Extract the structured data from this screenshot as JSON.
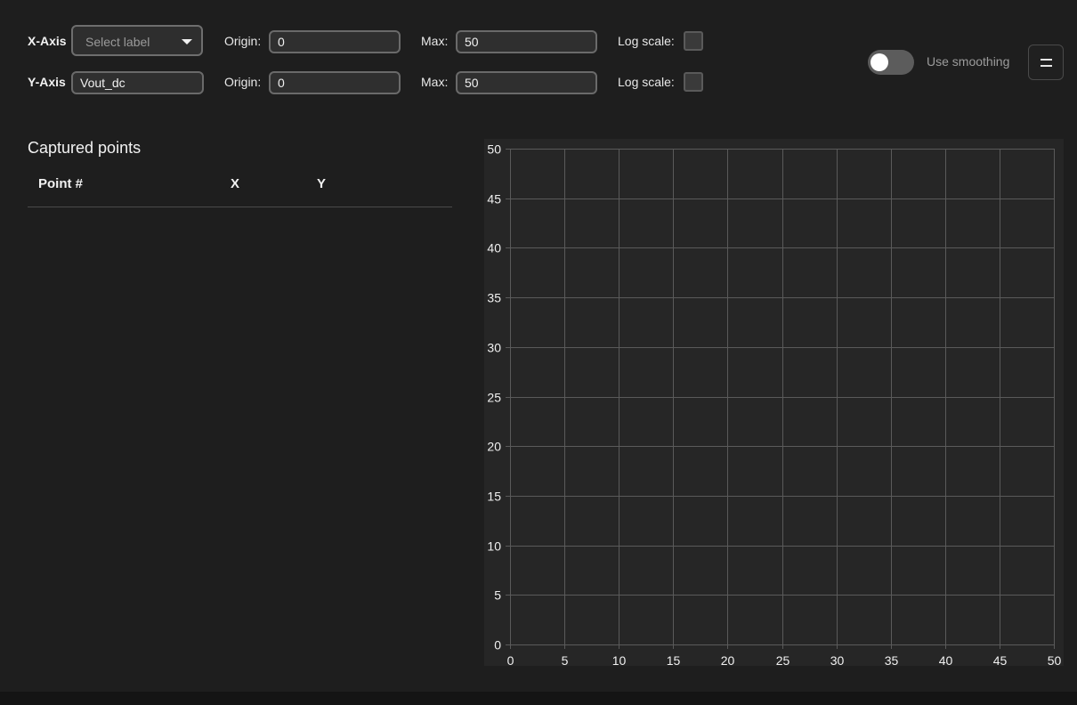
{
  "controls": {
    "x_axis": {
      "label": "X-Axis",
      "select_placeholder": "Select label",
      "origin_label": "Origin:",
      "origin_value": "0",
      "max_label": "Max:",
      "max_value": "50",
      "log_label": "Log scale:",
      "log_checked": false
    },
    "y_axis": {
      "label": "Y-Axis",
      "select_value": "Vout_dc",
      "origin_label": "Origin:",
      "origin_value": "0",
      "max_label": "Max:",
      "max_value": "50",
      "log_label": "Log scale:",
      "log_checked": false
    },
    "smoothing": {
      "label": "Use smoothing",
      "enabled": false
    },
    "menu_icon": "menu-icon"
  },
  "points_table": {
    "title": "Captured points",
    "columns": [
      "Point #",
      "X",
      "Y"
    ],
    "rows": []
  },
  "chart_data": {
    "type": "scatter",
    "x_ticks": [
      0,
      5,
      10,
      15,
      20,
      25,
      30,
      35,
      40,
      45,
      50
    ],
    "y_ticks": [
      0,
      5,
      10,
      15,
      20,
      25,
      30,
      35,
      40,
      45,
      50
    ],
    "xlim": [
      0,
      50
    ],
    "ylim": [
      0,
      50
    ],
    "grid": true,
    "series": [],
    "colors": {
      "background": "#262626",
      "grid": "#5a5a5a",
      "text": "#f0f0f0"
    }
  }
}
